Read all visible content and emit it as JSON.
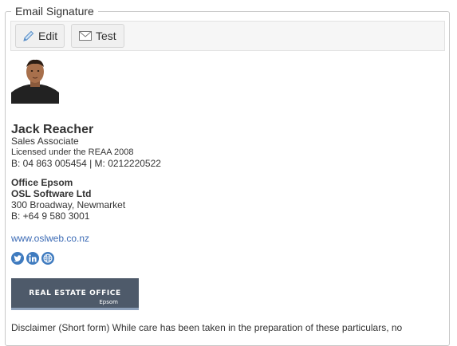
{
  "panel": {
    "legend": "Email Signature"
  },
  "toolbar": {
    "edit_label": "Edit",
    "test_label": "Test"
  },
  "signature": {
    "name": "Jack Reacher",
    "title": "Sales Associate",
    "license": "Licensed under the REAA 2008",
    "phones": "B: 04 863 005454 | M: 0212220522",
    "office_name": "Office Epsom",
    "company": "OSL Software Ltd",
    "address": "300 Broadway, Newmarket",
    "office_phone": "B: +64 9 580 3001",
    "website": "www.oslweb.co.nz",
    "banner_main": "REAL ESTATE OFFICE",
    "banner_sub": "Epsom",
    "disclaimer": "Disclaimer (Short form) While care has been taken in the preparation of these particulars, no"
  },
  "icons": [
    "pencil-icon",
    "envelope-icon",
    "twitter-icon",
    "linkedin-icon",
    "globe-icon"
  ],
  "colors": {
    "link": "#3c6bb5",
    "social": "#3f7bbf",
    "banner": "#4e5a6a",
    "banner_stripe": "#8ea1bb"
  }
}
